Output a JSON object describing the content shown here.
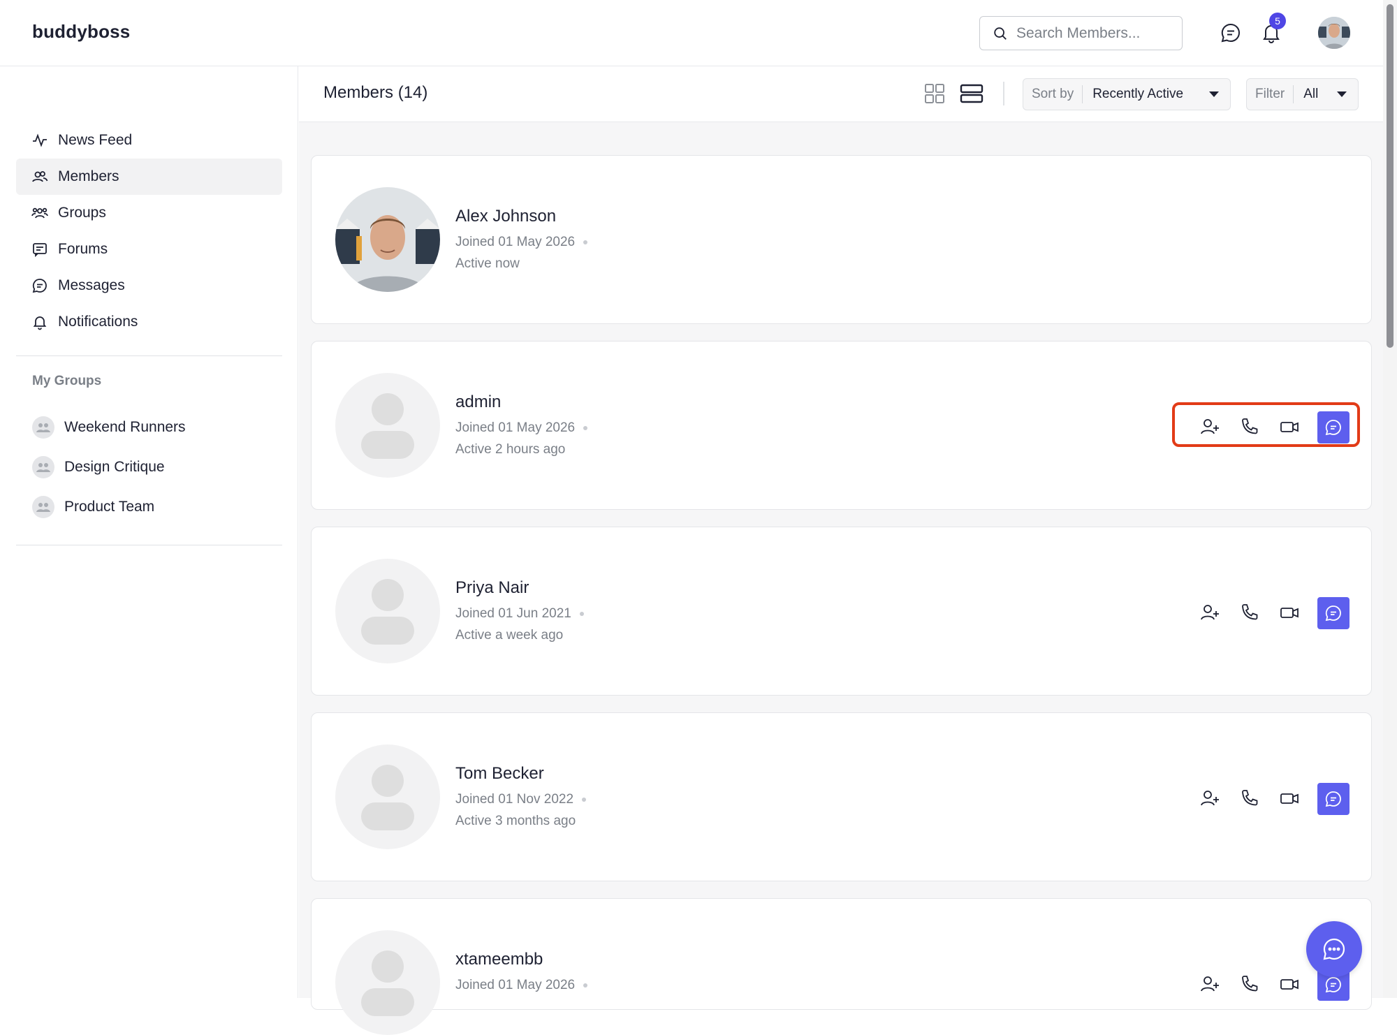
{
  "header": {
    "logo": "buddyboss",
    "search_placeholder": "Search Members...",
    "notification_count": "5"
  },
  "sidebar": {
    "items": [
      {
        "label": "News Feed",
        "icon": "activity-icon"
      },
      {
        "label": "Members",
        "icon": "members-icon",
        "active": true
      },
      {
        "label": "Groups",
        "icon": "groups-icon"
      },
      {
        "label": "Forums",
        "icon": "forums-icon"
      },
      {
        "label": "Messages",
        "icon": "messages-icon"
      },
      {
        "label": "Notifications",
        "icon": "bell-icon"
      }
    ],
    "my_groups_title": "My Groups",
    "groups": [
      {
        "label": "Weekend Runners"
      },
      {
        "label": "Design Critique"
      },
      {
        "label": "Product Team"
      }
    ]
  },
  "main": {
    "title": "Members (14)",
    "sort_label": "Sort by",
    "sort_value": "Recently Active",
    "filter_label": "Filter",
    "filter_value": "All",
    "members": [
      {
        "name": "Alex Johnson",
        "joined": "Joined 01 May 2026",
        "active": "Active now",
        "has_photo": true,
        "actions": false
      },
      {
        "name": "admin",
        "joined": "Joined 01 May 2026",
        "active": "Active 2 hours ago",
        "has_photo": false,
        "actions": true,
        "highlighted": true
      },
      {
        "name": "Priya Nair",
        "joined": "Joined 01 Jun 2021",
        "active": "Active a week ago",
        "has_photo": false,
        "actions": true
      },
      {
        "name": "Tom Becker",
        "joined": "Joined 01 Nov 2022",
        "active": "Active 3 months ago",
        "has_photo": false,
        "actions": true
      },
      {
        "name": "xtameembb",
        "joined": "Joined 01 May 2026",
        "active": "",
        "has_photo": false,
        "actions": true
      }
    ]
  },
  "colors": {
    "accent": "#5d5fee",
    "highlight": "#e23b17",
    "badge": "#4f46e5"
  }
}
